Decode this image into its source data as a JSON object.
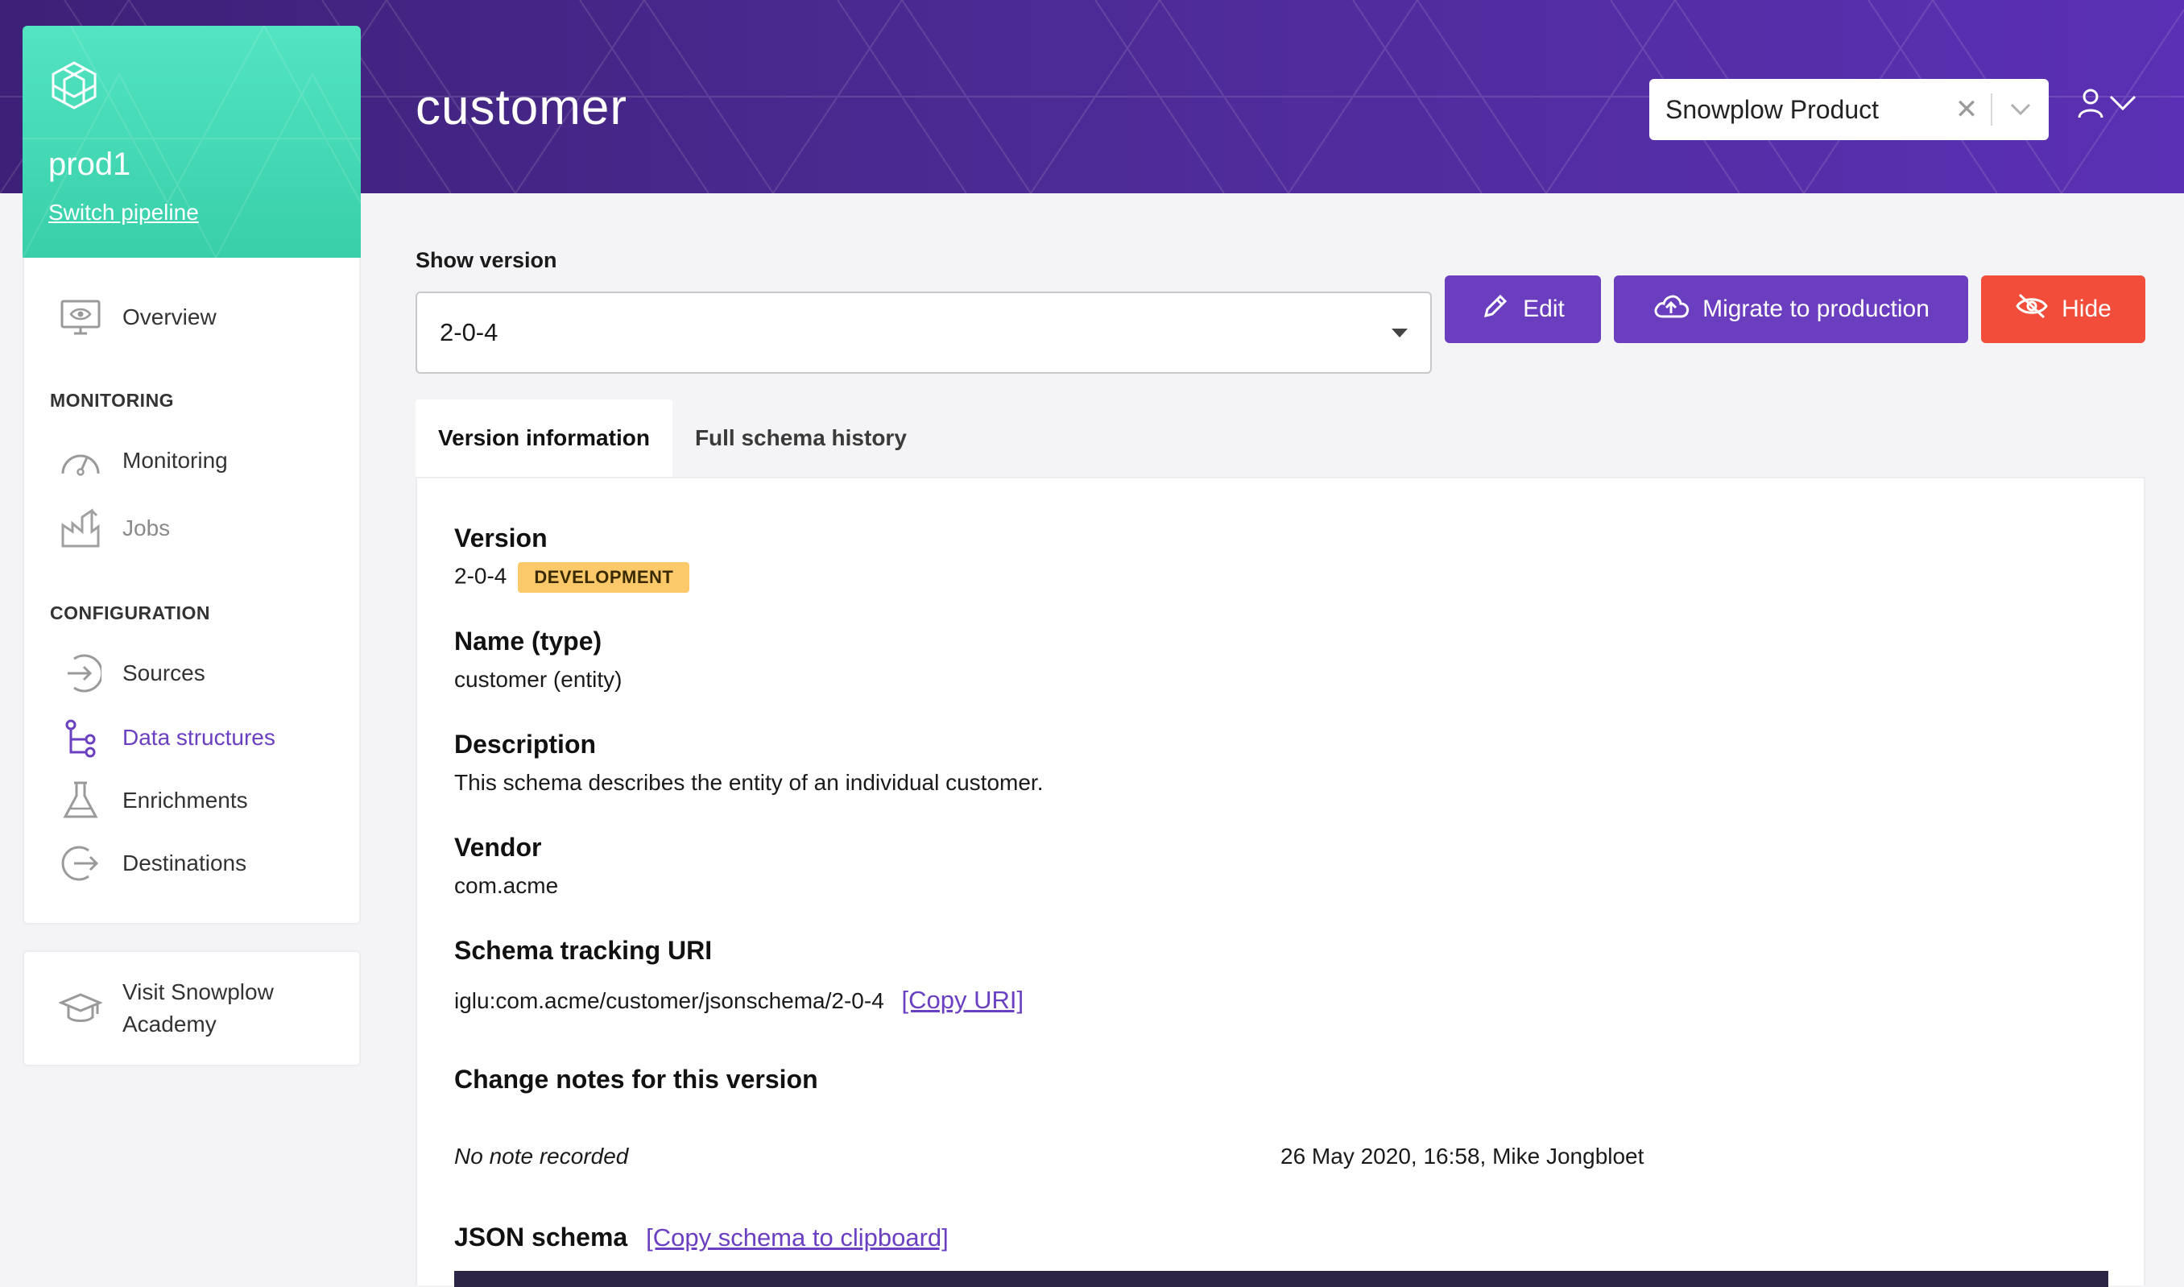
{
  "header": {
    "page_title": "customer",
    "org_select": {
      "value": "Snowplow Product",
      "clear_icon": "close-icon",
      "dropdown_icon": "chevron-down-icon"
    },
    "user_menu": {
      "icon": "user-icon"
    }
  },
  "pipeline": {
    "name": "prod1",
    "switch_label": "Switch pipeline"
  },
  "sidebar": {
    "overview": "Overview",
    "monitoring_section": "MONITORING",
    "monitoring": "Monitoring",
    "jobs": "Jobs",
    "configuration_section": "CONFIGURATION",
    "sources": "Sources",
    "data_structures": "Data structures",
    "enrichments": "Enrichments",
    "destinations": "Destinations",
    "academy": "Visit Snowplow Academy"
  },
  "version_picker": {
    "label": "Show version",
    "value": "2-0-4"
  },
  "actions": {
    "edit": "Edit",
    "migrate": "Migrate to production",
    "hide": "Hide"
  },
  "tabs": {
    "version_info": "Version information",
    "schema_history": "Full schema history"
  },
  "details": {
    "version_label": "Version",
    "version_value": "2-0-4",
    "version_badge": "DEVELOPMENT",
    "name_label": "Name (type)",
    "name_value": "customer (entity)",
    "description_label": "Description",
    "description_value": "This schema describes the entity of an individual customer.",
    "vendor_label": "Vendor",
    "vendor_value": "com.acme",
    "uri_label": "Schema tracking URI",
    "uri_value": "iglu:com.acme/customer/jsonschema/2-0-4",
    "copy_uri": "[Copy URI]",
    "change_notes_label": "Change notes for this version",
    "no_note": "No note recorded",
    "note_meta": "26 May 2020, 16:58, Mike Jongbloet",
    "json_label": "JSON schema",
    "copy_schema": "[Copy schema to clipboard]"
  },
  "colors": {
    "header_start": "#3d2077",
    "header_end": "#5b30b4",
    "pipeline_card": "#43d9b5",
    "primary_button": "#6a3ebf",
    "danger_button": "#f24d3a",
    "badge": "#fcc96a",
    "active_nav": "#6a3fc1"
  }
}
